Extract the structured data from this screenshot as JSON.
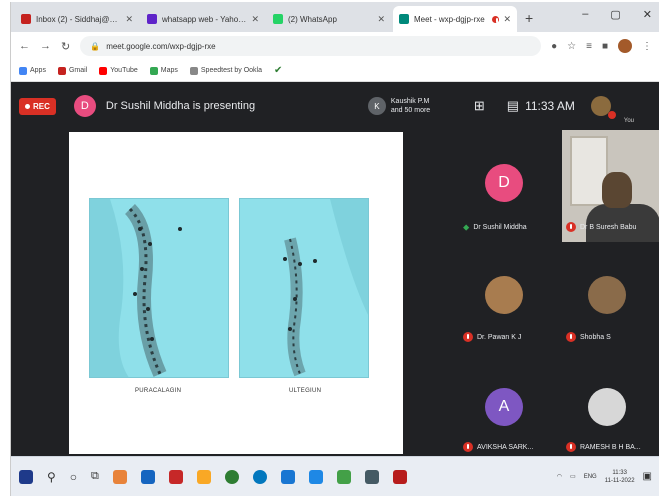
{
  "browser": {
    "tabs": [
      {
        "label": "Inbox (2) - Siddhaj@sailm...",
        "color": "#c5221f",
        "active": false
      },
      {
        "label": "whatsapp web - Yahoo Sear...",
        "color": "#5f24c9",
        "active": false
      },
      {
        "label": "(2) WhatsApp",
        "color": "#25d366",
        "active": false
      },
      {
        "label": "Meet - wxp-dgjp-rxe",
        "color": "#00897b",
        "active": true
      }
    ],
    "new_tab_glyph": "+",
    "window_controls": [
      "–",
      "▢",
      "✕"
    ],
    "url": "meet.google.com/wxp-dgjp-rxe",
    "bookmarks": [
      {
        "label": "Apps",
        "color": "#4285f4"
      },
      {
        "label": "Gmail",
        "color": "#c5221f"
      },
      {
        "label": "YouTube",
        "color": "#ff0000"
      },
      {
        "label": "Maps",
        "color": "#34a853"
      },
      {
        "label": "Speedtest by Ookla",
        "color": "#888888"
      }
    ]
  },
  "meet": {
    "rec_label": "REC",
    "presenter_initial": "D",
    "presenter_text": "Dr Sushil Middha is presenting",
    "viewers_initial": "K",
    "viewers_line1": "Kaushik P.M",
    "viewers_line2": "and 50 more",
    "clock": "11:33 AM",
    "self_label": "You",
    "slide": {
      "caption_left": "PURACALAGIN",
      "caption_right": "ULTEGIUN"
    },
    "participants": [
      {
        "name": "Dr Sushil Middha",
        "initial": "D",
        "color": "#e84c7f",
        "speaking": true
      },
      {
        "name": "Dr B Suresh Babu",
        "initial": "",
        "color": "",
        "video": true
      },
      {
        "name": "Dr. Pawan K J",
        "initial": "",
        "color": "#a87c4f"
      },
      {
        "name": "Shobha S",
        "initial": "",
        "color": "#8a6b4a"
      },
      {
        "name": "AVIKSHA SARK...",
        "initial": "A",
        "color": "#7e57c2"
      },
      {
        "name": "RAMESH B H BA...",
        "initial": "",
        "color": "#d7d7d7"
      }
    ]
  },
  "taskbar": {
    "icons": [
      "windows-icon",
      "search-icon",
      "cortana-icon",
      "task-view-icon",
      "app-icon",
      "app-icon",
      "app-icon",
      "app-icon",
      "chrome-icon",
      "app-icon",
      "app-icon",
      "app-icon",
      "app-icon",
      "app-icon",
      "app-icon",
      "app-icon"
    ],
    "tray_lang": "ENG",
    "time": "11:33",
    "date": "11-11-2022"
  }
}
